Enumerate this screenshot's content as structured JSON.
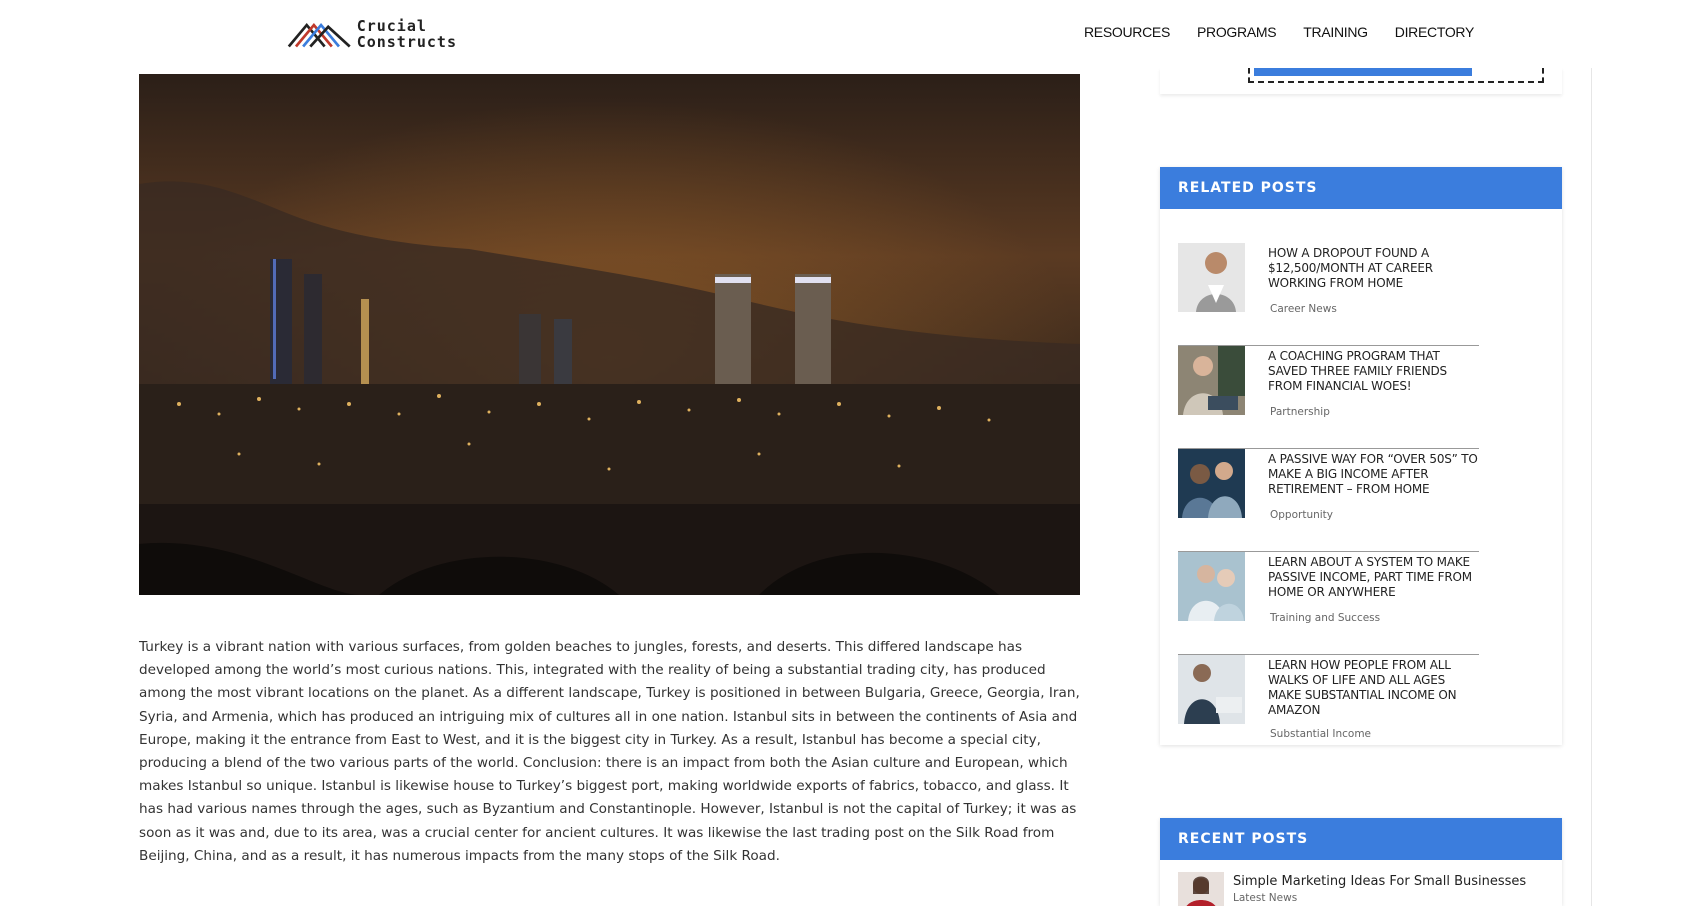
{
  "header": {
    "logo_line1": "Crucial",
    "logo_line2": "Constructs",
    "nav": [
      "RESOURCES",
      "PROGRAMS",
      "TRAINING",
      "DIRECTORY"
    ]
  },
  "article": {
    "body": "Turkey is a vibrant nation with various surfaces, from golden beaches to jungles, forests, and deserts. This differed landscape has developed among the world’s most curious nations. This, integrated with the reality of being a substantial trading city, has produced among the most vibrant locations on the planet. As a different landscape, Turkey is positioned in between Bulgaria, Greece, Georgia, Iran, Syria, and Armenia, which has produced an intriguing mix of cultures all in one nation. Istanbul sits in between the continents of Asia and Europe, making it the entrance from East to West, and it is the biggest city in Turkey. As a result, Istanbul has become a special city, producing a blend of the two various parts of the world. Conclusion: there is an impact from both the Asian culture and European, which makes Istanbul so unique. Istanbul is likewise house to Turkey’s biggest port, making worldwide exports of fabrics, tobacco, and glass. It has had various names through the ages, such as Byzantium and Constantinople. However, Istanbul is not the capital of Turkey; it was as soon as it was and, due to its area, was a crucial center for ancient cultures. It was likewise the last trading post on the Silk Road from Beijing, China, and as a result, it has numerous impacts from the many stops of the Silk Road."
  },
  "sidebar": {
    "related_title": "RELATED POSTS",
    "related": [
      {
        "title": "HOW A DROPOUT FOUND A $12,500/MONTH AT CAREER WORKING FROM HOME",
        "category": "Career News"
      },
      {
        "title": "A COACHING PROGRAM THAT SAVED THREE FAMILY FRIENDS FROM FINANCIAL WOES!",
        "category": "Partnership"
      },
      {
        "title": "A PASSIVE WAY FOR “OVER 50S” TO MAKE A BIG INCOME AFTER RETIREMENT – FROM HOME",
        "category": "Opportunity"
      },
      {
        "title": "LEARN ABOUT A SYSTEM TO MAKE PASSIVE INCOME, PART TIME FROM HOME OR ANYWHERE",
        "category": "Training and Success"
      },
      {
        "title": "LEARN HOW PEOPLE FROM ALL WALKS OF LIFE AND ALL AGES MAKE SUBSTANTIAL INCOME ON AMAZON",
        "category": "Substantial Income"
      }
    ],
    "recent_title": "RECENT POSTS",
    "recent": [
      {
        "title": "Simple Marketing Ideas For Small Businesses",
        "category": "Latest News"
      }
    ]
  },
  "colors": {
    "accent": "#3b7ddd",
    "text": "#333333"
  }
}
